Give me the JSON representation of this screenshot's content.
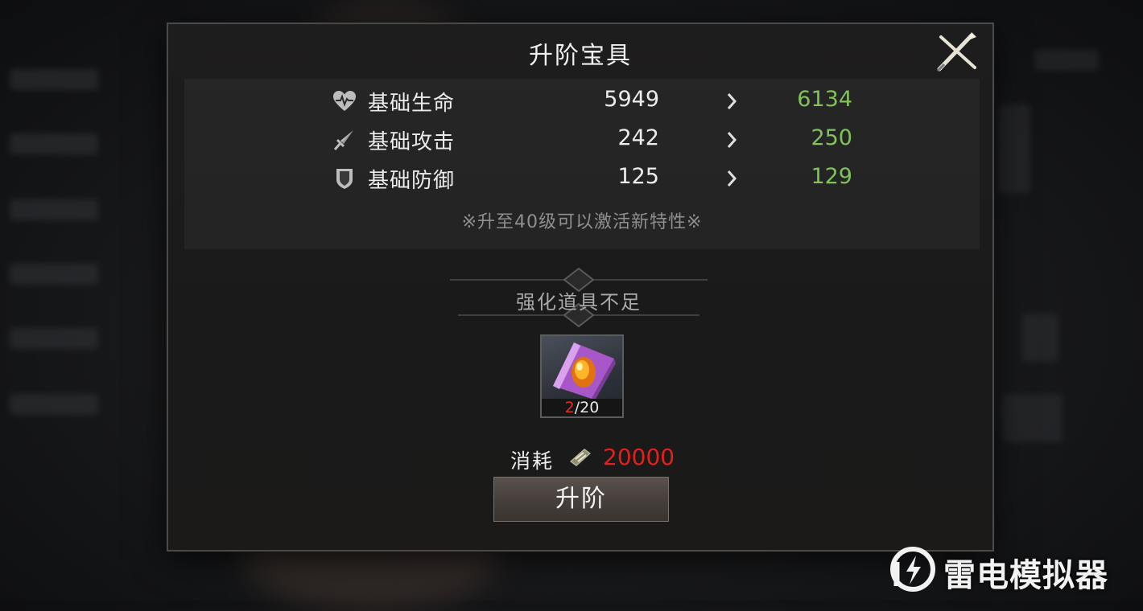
{
  "dialog": {
    "title": "升阶宝具"
  },
  "stats": [
    {
      "icon": "heart-icon",
      "label": "基础生命",
      "current": "5949",
      "next": "6134"
    },
    {
      "icon": "sword-icon",
      "label": "基础攻击",
      "current": "242",
      "next": "250"
    },
    {
      "icon": "shield-icon",
      "label": "基础防御",
      "current": "125",
      "next": "129"
    }
  ],
  "stats_note": "※升至40级可以激活新特性※",
  "material": {
    "banner": "强化道具不足",
    "owned": "2",
    "required": "/20",
    "owned_color": "#e62a2a"
  },
  "cost": {
    "label": "消耗",
    "icon": "cash-icon",
    "value": "20000",
    "value_color": "#e61e1e"
  },
  "upgrade_button": "升阶",
  "watermark": "雷电模拟器",
  "colors": {
    "next_value": "#7fc35a",
    "cost_red": "#e61e1e"
  }
}
